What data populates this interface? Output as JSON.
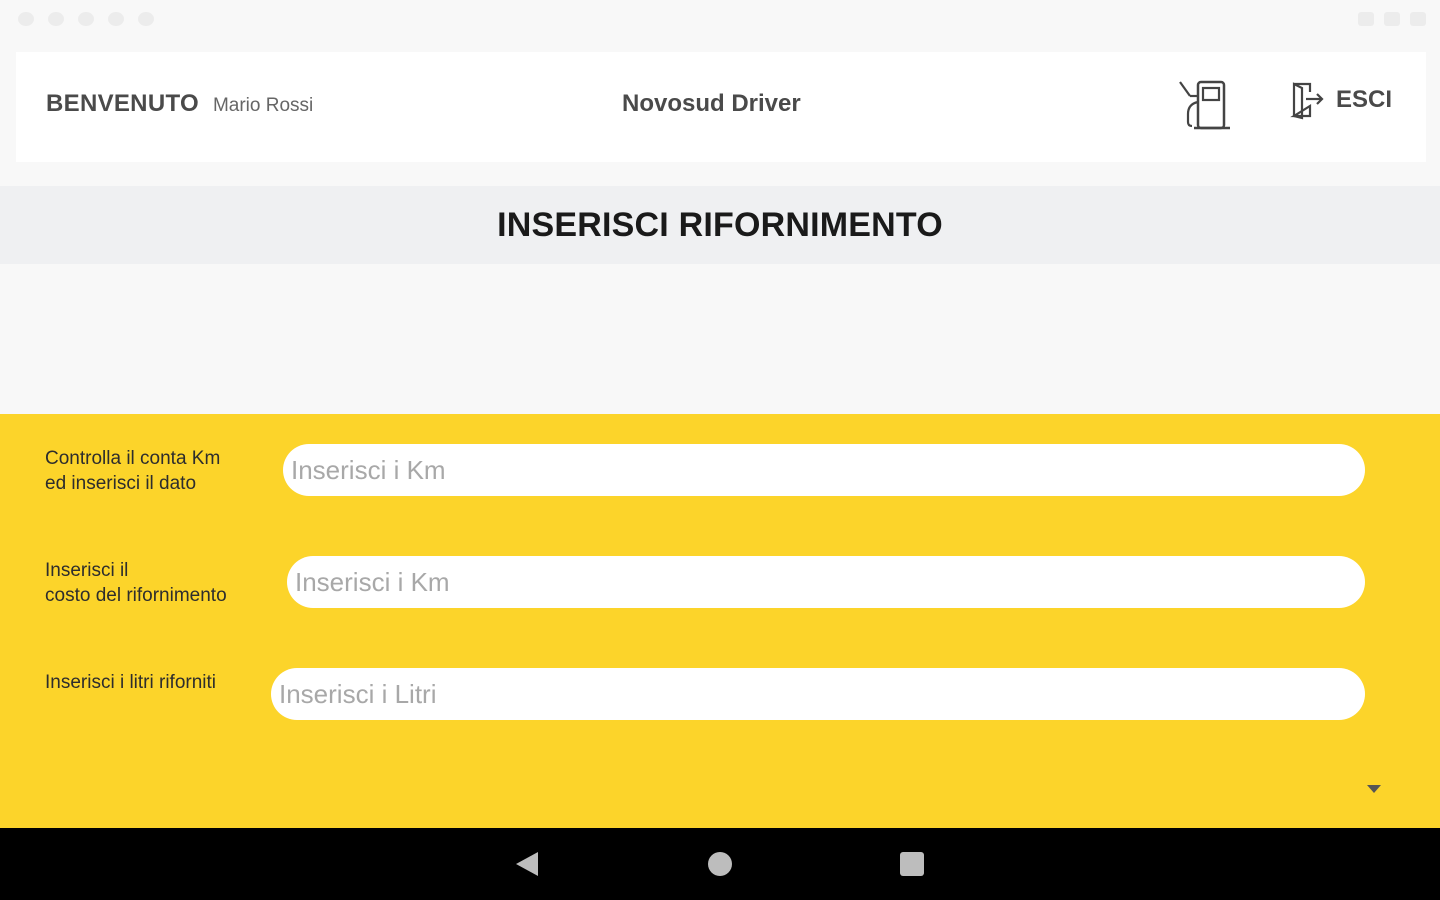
{
  "header": {
    "welcome_label": "BENVENUTO",
    "user_name": "Mario Rossi",
    "app_title": "Novosud Driver",
    "logout_label": "ESCI"
  },
  "page": {
    "title": "INSERISCI RIFORNIMENTO"
  },
  "form": {
    "km_label_line1": "Controlla il conta Km",
    "km_label_line2": " ed inserisci il dato",
    "km_placeholder": "Inserisci i Km",
    "cost_label_line1": "Inserisci il",
    "cost_label_line2": " costo del rifornimento",
    "cost_placeholder": "Inserisci i Km",
    "liters_label": "Inserisci i litri riforniti",
    "liters_placeholder": "Inserisci i Litri"
  },
  "colors": {
    "accent": "#fcd42a",
    "title_band": "#eff0f2",
    "background": "#f8f8f8",
    "nav_bar": "#000000"
  },
  "icons": {
    "fuel": "fuel-pump-icon",
    "logout": "door-exit-icon",
    "dropdown": "caret-down-icon",
    "nav_back": "back-triangle-icon",
    "nav_home": "home-circle-icon",
    "nav_recent": "recent-square-icon"
  }
}
